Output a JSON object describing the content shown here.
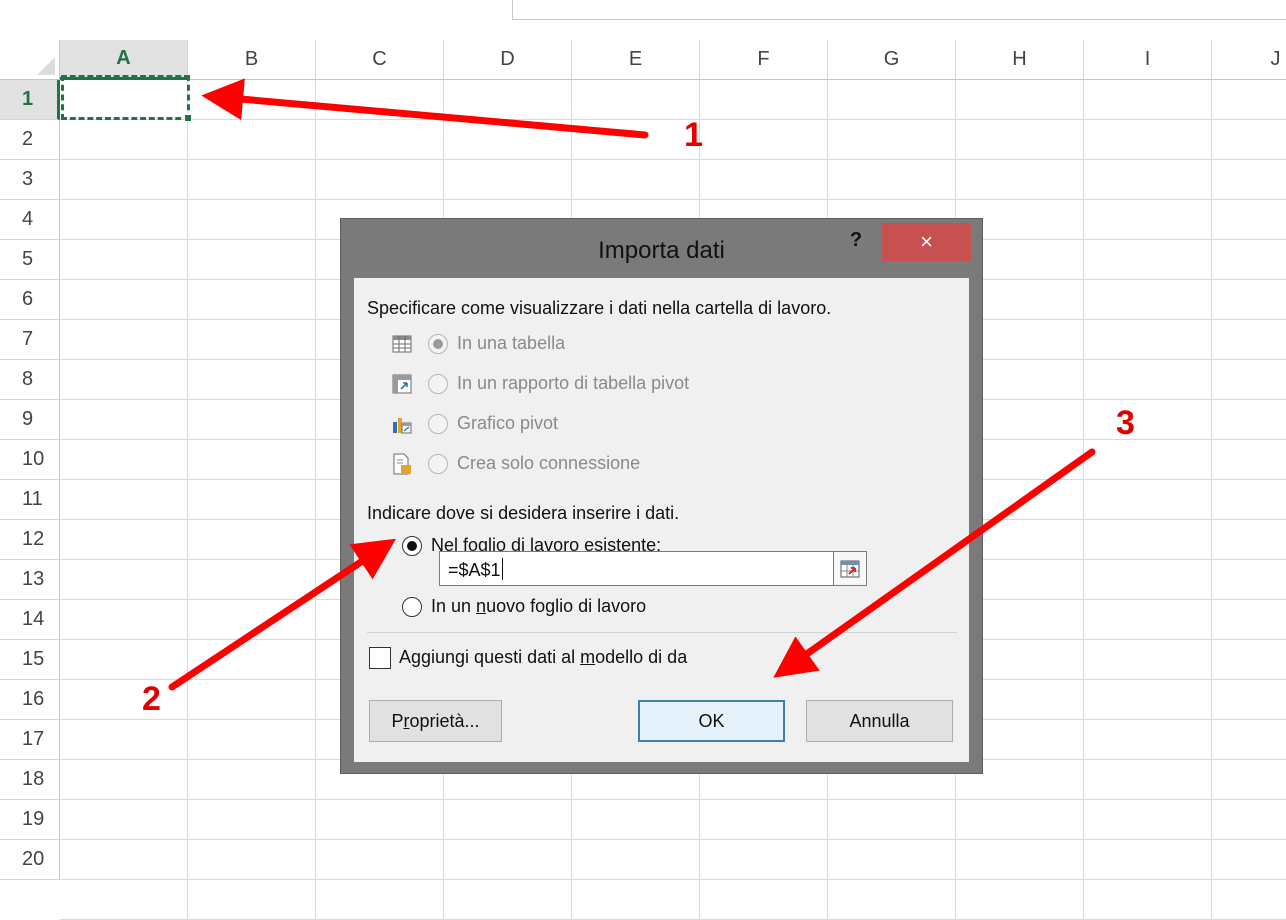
{
  "sheet": {
    "columns": [
      "A",
      "B",
      "C",
      "D",
      "E",
      "F",
      "G",
      "H",
      "I",
      "J"
    ],
    "active_column": "A",
    "rows": [
      "1",
      "2",
      "3",
      "4",
      "5",
      "6",
      "7",
      "8",
      "9",
      "10",
      "11",
      "12",
      "13",
      "14",
      "15",
      "16",
      "17",
      "18",
      "19",
      "20"
    ],
    "active_row": "1"
  },
  "dialog": {
    "title": "Importa dati",
    "help_label": "?",
    "close_label": "×",
    "view_heading": "Specificare come visualizzare i dati nella cartella di lavoro.",
    "view_options": [
      {
        "label": "In una tabella",
        "selected": true,
        "enabled": false,
        "icon": "table-icon"
      },
      {
        "label": "In un rapporto di tabella pivot",
        "selected": false,
        "enabled": false,
        "icon": "pivot-table-icon"
      },
      {
        "label": "Grafico pivot",
        "selected": false,
        "enabled": false,
        "icon": "pivot-chart-icon"
      },
      {
        "label": "Crea solo connessione",
        "selected": false,
        "enabled": false,
        "icon": "connection-icon"
      }
    ],
    "location_heading": "Indicare dove si desidera inserire i dati.",
    "location_existing": {
      "pre": "Nel foglio di lavoro e",
      "accel": "s",
      "post": "istente:"
    },
    "location_new": {
      "pre": "In un ",
      "accel": "n",
      "post": "uovo foglio di lavoro"
    },
    "reference_value": "=$A$1",
    "data_model": {
      "pre": "Aggiungi questi dati al ",
      "accel": "m",
      "post": "odello di da"
    },
    "buttons": {
      "properties": {
        "pre": "P",
        "accel": "r",
        "post": "oprietà..."
      },
      "ok": "OK",
      "cancel": "Annulla"
    }
  },
  "annotations": {
    "step1": "1",
    "step2": "2",
    "step3": "3",
    "arrow_color": "#ff0000"
  }
}
